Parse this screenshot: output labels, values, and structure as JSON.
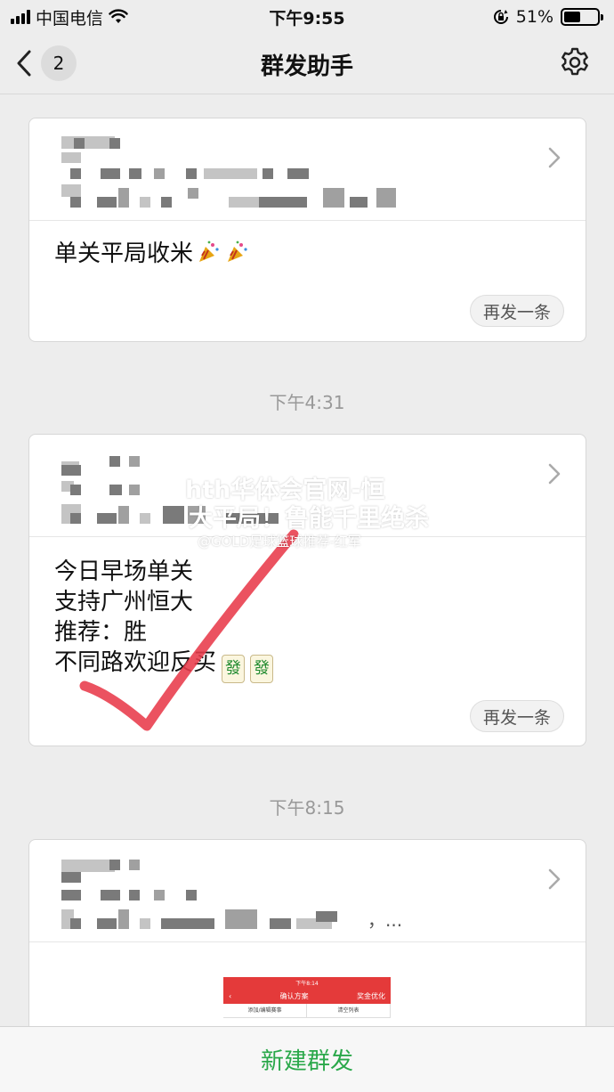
{
  "status_bar": {
    "carrier": "中国电信",
    "time": "下午9:55",
    "battery": "51%",
    "battery_level": 0.51
  },
  "nav": {
    "back_count": "2",
    "title": "群发助手"
  },
  "messages": [
    {
      "text_lines": [
        "单关平局收米"
      ],
      "trailing_emoji": [
        "party-popper-icon",
        "party-popper-icon"
      ],
      "resend_label": "再发一条"
    },
    {
      "timestamp": "下午4:31",
      "text_lines": [
        "今日早场单关",
        "支持广州恒大",
        "推荐：胜",
        "不同路欢迎反买"
      ],
      "trailing_emoji": [
        "mahjong-fa-icon",
        "mahjong-fa-icon"
      ],
      "mahjong_glyph": "發",
      "resend_label": "再发一条"
    },
    {
      "timestamp": "下午8:15",
      "recipient_tail": "，...",
      "thumbnail": {
        "status_time": "下午8:14",
        "title": "确认方案",
        "right_action": "奖金优化",
        "tab_add": "添加/编辑赛事",
        "tab_clear": "清空列表"
      }
    }
  ],
  "watermark": {
    "line1": "hth华体会官网-恒",
    "line2": "大平局！鲁能千里绝杀",
    "line3": "@GOLD足球篮球推荐-红军"
  },
  "bottom": {
    "new_broadcast_label": "新建群发"
  },
  "colors": {
    "accent_green": "#2aa84a",
    "check_red": "#e83a4a",
    "background": "#ededed"
  }
}
